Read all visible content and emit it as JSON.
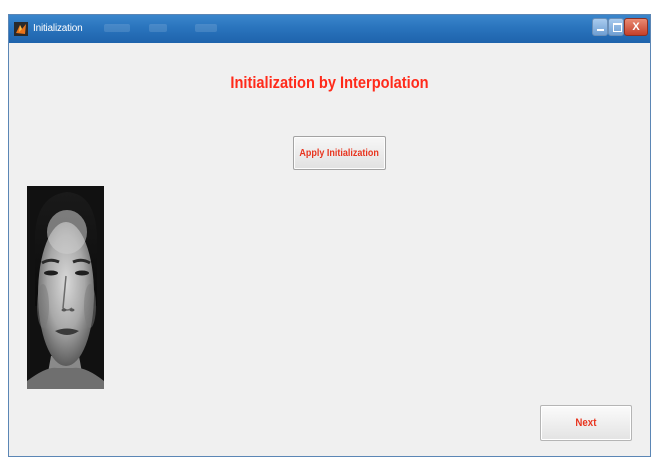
{
  "window": {
    "title": "Initialization",
    "icon": "matlab-icon",
    "controls": {
      "minimize": "minimize-icon",
      "maximize": "maximize-icon",
      "close_label": "X"
    }
  },
  "main": {
    "heading": "Initialization by Interpolation",
    "apply_button_label": "Apply Initialization",
    "image": {
      "kind": "grayscale face photograph"
    },
    "next_button_label": "Next"
  },
  "colors": {
    "accent_text": "#ff2a1a",
    "titlebar": "#2a74bd",
    "background": "#f0f0f0"
  }
}
